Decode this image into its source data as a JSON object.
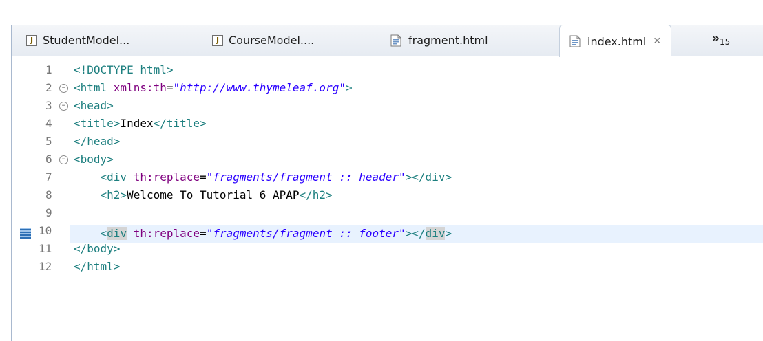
{
  "tabs": [
    {
      "label": "StudentModel...",
      "icon": "java-file-icon",
      "active": false
    },
    {
      "label": "CourseModel....",
      "icon": "java-file-icon",
      "active": false
    },
    {
      "label": "fragment.html",
      "icon": "html-file-icon",
      "active": false
    },
    {
      "label": "index.html",
      "icon": "html-file-icon",
      "active": true
    }
  ],
  "close_glyph": "✕",
  "overflow": {
    "chevron": "»",
    "count": "15"
  },
  "lines": [
    {
      "n": "1"
    },
    {
      "n": "2"
    },
    {
      "n": "3"
    },
    {
      "n": "4"
    },
    {
      "n": "5"
    },
    {
      "n": "6"
    },
    {
      "n": "7"
    },
    {
      "n": "8"
    },
    {
      "n": "9"
    },
    {
      "n": "10"
    },
    {
      "n": "11"
    },
    {
      "n": "12"
    }
  ],
  "code": {
    "l1": {
      "a": "<!DOCTYPE html>"
    },
    "l2": {
      "open": "<html ",
      "attr": "xmlns:th",
      "eq": "=",
      "val": "\"http://www.thymeleaf.org\"",
      "close": ">"
    },
    "l3": {
      "tag": "<head>"
    },
    "l4": {
      "open": "<title>",
      "text": "Index",
      "close": "</title>"
    },
    "l5": {
      "tag": "</head>"
    },
    "l6": {
      "tag": "<body>"
    },
    "l7": {
      "indent": "    ",
      "open": "<div ",
      "attr": "th:replace",
      "eq": "=",
      "val": "\"fragments/fragment :: header\"",
      "close": "></div>"
    },
    "l8": {
      "indent": "    ",
      "open": "<h2>",
      "text": "Welcome To Tutorial 6 APAP",
      "close": "</h2>"
    },
    "l9": {
      "indent": "    ",
      "lt": "<",
      "div1": "div",
      "sp": " ",
      "attr": "th:replace",
      "eq": "=",
      "val": "\"fragments/fragment :: footer\"",
      "mid": "></",
      "div2": "div",
      "gt": ">"
    },
    "l10": {
      "tag": "</body>"
    },
    "l11": {
      "tag": "</html>"
    }
  },
  "colors": {
    "tag": "#1d7f7f",
    "attr": "#7f007f",
    "string": "#2a00ff",
    "current_line": "#e8f2fe"
  }
}
